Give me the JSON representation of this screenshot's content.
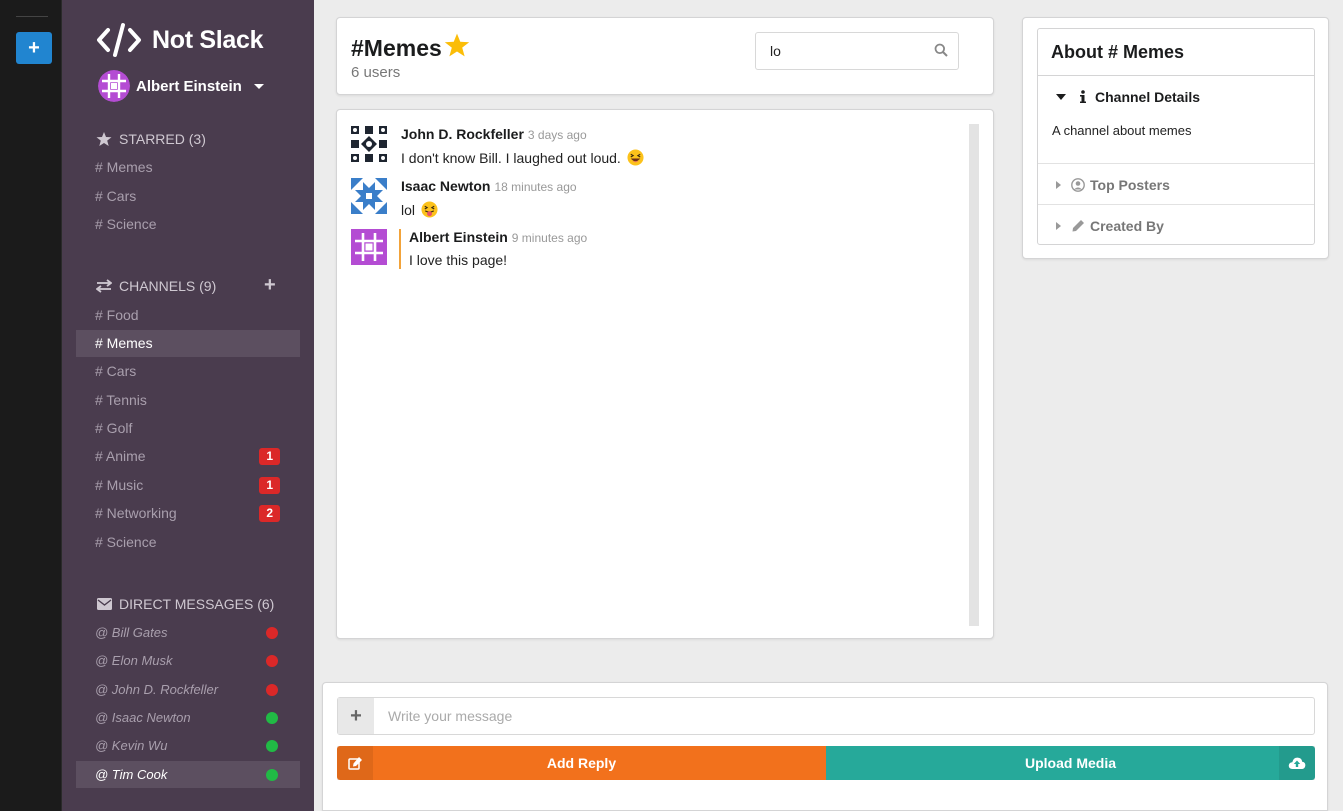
{
  "app": {
    "name": "Not Slack"
  },
  "rail": {
    "add_label": "+"
  },
  "user": {
    "name": "Albert Einstein"
  },
  "starred": {
    "header": "STARRED (3)",
    "items": [
      "# Memes",
      "# Cars",
      "# Science"
    ]
  },
  "channels": {
    "header": "CHANNELS (9)",
    "items": [
      {
        "label": "# Food",
        "badge": null
      },
      {
        "label": "# Memes",
        "badge": null,
        "active": true
      },
      {
        "label": "# Cars",
        "badge": null
      },
      {
        "label": "# Tennis",
        "badge": null
      },
      {
        "label": "# Golf",
        "badge": null
      },
      {
        "label": "# Anime",
        "badge": "1"
      },
      {
        "label": "# Music",
        "badge": "1"
      },
      {
        "label": "# Networking",
        "badge": "2"
      },
      {
        "label": "# Science",
        "badge": null
      }
    ]
  },
  "direct_messages": {
    "header": "DIRECT MESSAGES (6)",
    "items": [
      {
        "label": "@ Bill Gates",
        "status": "offline"
      },
      {
        "label": "@ Elon Musk",
        "status": "offline"
      },
      {
        "label": "@ John D. Rockfeller",
        "status": "offline"
      },
      {
        "label": "@ Isaac Newton",
        "status": "online"
      },
      {
        "label": "@ Kevin Wu",
        "status": "online"
      },
      {
        "label": "@ Tim Cook",
        "status": "online",
        "active": true
      }
    ]
  },
  "channel": {
    "title": "#Memes",
    "users": "6 users",
    "search_value": "lo"
  },
  "messages": [
    {
      "author": "John D. Rockfeller",
      "time": "3 days ago",
      "text": "I don't know Bill. I laughed out loud.",
      "emoji": "laughing"
    },
    {
      "author": "Isaac Newton",
      "time": "18 minutes ago",
      "text": "lol",
      "emoji": "tongue"
    },
    {
      "author": "Albert Einstein",
      "time": "9 minutes ago",
      "text": "I love this page!",
      "emoji": null
    }
  ],
  "about": {
    "title": "About # Memes",
    "details_label": "Channel Details",
    "details_text": "A channel about memes",
    "top_posters_label": "Top Posters",
    "created_by_label": "Created By"
  },
  "composer": {
    "placeholder": "Write your message",
    "reply_label": "Add Reply",
    "upload_label": "Upload Media"
  },
  "colors": {
    "sidebar": "#4a3c4e",
    "rail": "#1b1b1b",
    "primary": "#2185d0",
    "reply": "#f2711c",
    "upload": "#26a99a",
    "badge": "#db2828",
    "online": "#21ba45",
    "star": "#fbbd08"
  }
}
